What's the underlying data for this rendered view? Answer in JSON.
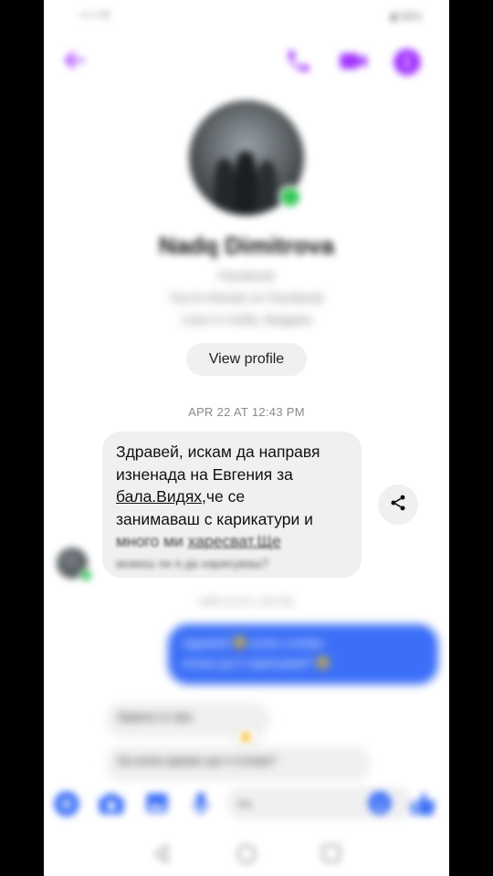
{
  "status_bar": {
    "left": "ᵛ⁴⁾ ⁽ᴸᵀᴱ",
    "right": "▮ 55%"
  },
  "colors": {
    "accent": "#a033ff",
    "sent_bubble": "#3b6ff7",
    "online": "#35c759"
  },
  "header": {
    "back_icon": "back-arrow-icon",
    "call_icon": "phone-icon",
    "video_icon": "video-camera-icon",
    "info_icon": "info-icon"
  },
  "profile": {
    "name": "Nadq Dimitrova",
    "source": "Facebook",
    "friends_line": "You're friends on Facebook",
    "location_line": "Lives in Sofia, Bulgaria",
    "view_profile_label": "View profile"
  },
  "conversation": {
    "timestamp_1": "APR 22 AT 12:43 PM",
    "incoming_message": {
      "line1": "Здравей, искам да направя",
      "line2": "изненада на Евгения за",
      "line3_underlined": "бала.Видях",
      "line3_rest": ",че се",
      "line4": "занимаваш с карикатури и",
      "line5_start": "много ми ",
      "line5_underlined": "харесват.Ще",
      "line6": "можеш ли я да нарисуваш?"
    },
    "timestamp_2": "APR 22 AT 1:05 PM",
    "outgoing_message": {
      "line1": "Здравей 😂 колко голяма",
      "line2": "искаш да я нарисувам? 😂"
    },
    "incoming_reply_1": "Зависи от вас",
    "incoming_reply_2": "За колко време ще я готова?"
  },
  "composer": {
    "placeholder": "Aa",
    "icons": [
      "menu-icon",
      "camera-icon",
      "gallery-icon",
      "microphone-icon",
      "emoji-icon",
      "thumbs-up-icon"
    ]
  },
  "nav": {
    "back": "nav-back-icon",
    "home": "nav-home-icon",
    "recents": "nav-recents-icon"
  }
}
